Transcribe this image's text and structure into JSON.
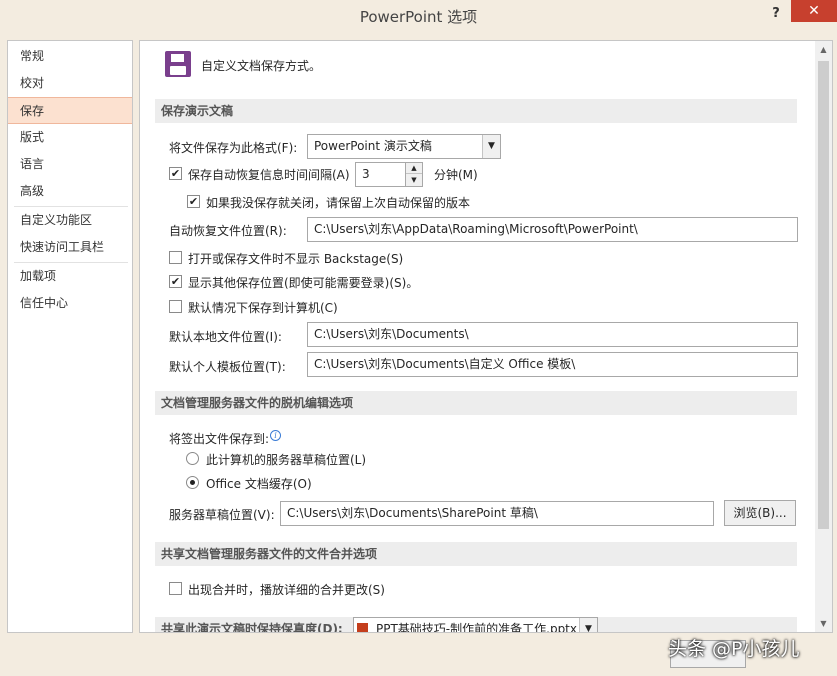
{
  "window": {
    "title": "PowerPoint 选项",
    "help": "?",
    "close": "✕"
  },
  "sidebar": {
    "items": [
      "常规",
      "校对",
      "保存",
      "版式",
      "语言",
      "高级",
      "自定义功能区",
      "快速访问工具栏",
      "加载项",
      "信任中心"
    ],
    "active": "保存"
  },
  "header": {
    "text": "自定义文档保存方式。",
    "icon": "floppy-disk-icon"
  },
  "sections": {
    "save": "保存演示文稿",
    "offline": "文档管理服务器文件的脱机编辑选项",
    "merge": "共享文档管理服务器文件的文件合并选项",
    "fidelity": "共享此演示文稿时保持保真度(D):"
  },
  "save": {
    "format_label": "将文件保存为此格式(F):",
    "format_value": "PowerPoint 演示文稿",
    "autorecover_label": "保存自动恢复信息时间间隔(A)",
    "autorecover_checked": true,
    "autorecover_minutes": "3",
    "minutes_unit": "分钟(M)",
    "keep_last_label": "如果我没保存就关闭，请保留上次自动保留的版本",
    "keep_last_checked": true,
    "autorecover_location_label": "自动恢复文件位置(R):",
    "autorecover_location_value": "C:\\Users\\刘东\\AppData\\Roaming\\Microsoft\\PowerPoint\\",
    "no_backstage_label": "打开或保存文件时不显示 Backstage(S)",
    "no_backstage_checked": false,
    "show_additional_label": "显示其他保存位置(即使可能需要登录)(S)。",
    "show_additional_checked": true,
    "save_to_computer_label": "默认情况下保存到计算机(C)",
    "save_to_computer_checked": false,
    "default_local_label": "默认本地文件位置(I):",
    "default_local_value": "C:\\Users\\刘东\\Documents\\",
    "default_template_label": "默认个人模板位置(T):",
    "default_template_value": "C:\\Users\\刘东\\Documents\\自定义 Office 模板\\"
  },
  "offline": {
    "save_checked_out_label": "将签出文件保存到:",
    "option_server": "此计算机的服务器草稿位置(L)",
    "option_cache": "Office 文档缓存(O)",
    "selected": "cache",
    "drafts_label": "服务器草稿位置(V):",
    "drafts_value": "C:\\Users\\刘东\\Documents\\SharePoint 草稿\\",
    "browse_label": "浏览(B)..."
  },
  "merge": {
    "show_changes_label": "出现合并时，播放详细的合并更改(S)",
    "show_changes_checked": false
  },
  "fidelity": {
    "file_value": "PPT基础技巧-制作前的准备工作.pptx"
  },
  "watermark": "头条 @P小孩儿"
}
